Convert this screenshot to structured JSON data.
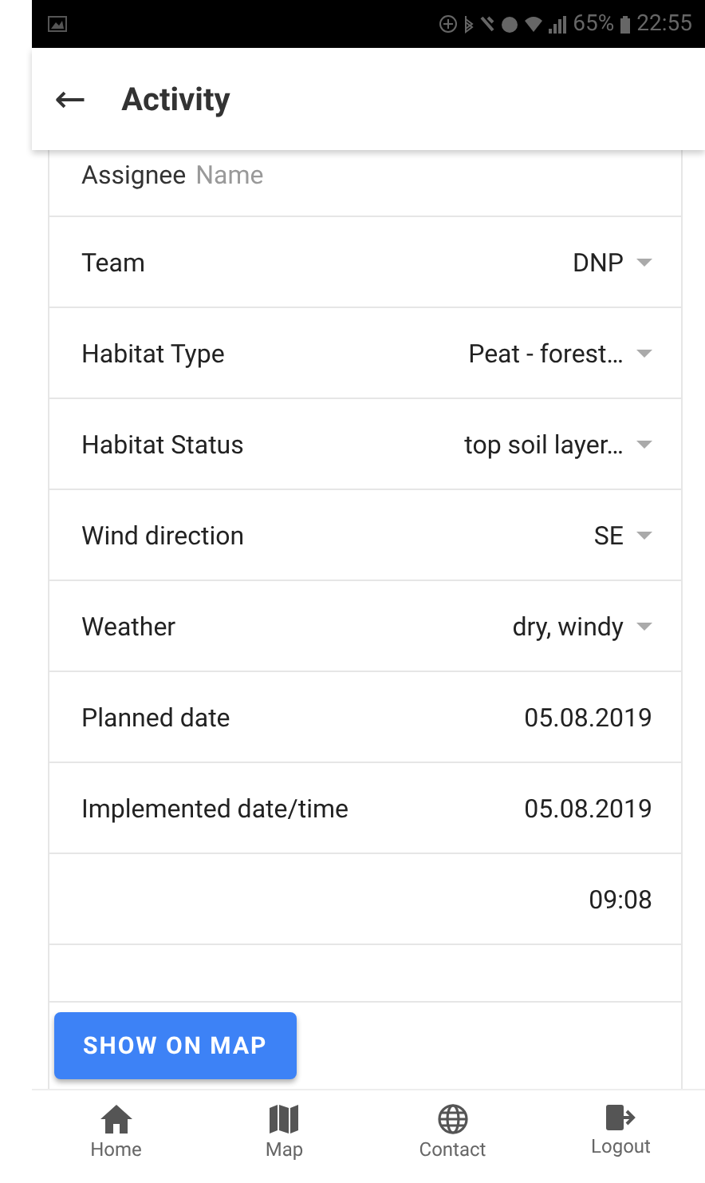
{
  "status_bar": {
    "battery": "65%",
    "time": "22:55"
  },
  "app_bar": {
    "back": "←",
    "title": "Activity"
  },
  "assignee": {
    "label": "Assignee",
    "placeholder": "Name"
  },
  "fields": [
    {
      "kind": "select",
      "label": "Team",
      "value": "DNP"
    },
    {
      "kind": "select",
      "label": "Habitat Type",
      "value": "Peat - forest…"
    },
    {
      "kind": "select",
      "label": "Habitat Status",
      "value": "top soil layer…"
    },
    {
      "kind": "select",
      "label": "Wind direction",
      "value": "SE"
    },
    {
      "kind": "select",
      "label": "Weather",
      "value": "dry, windy"
    },
    {
      "kind": "date",
      "label": "Planned date",
      "value": "05.08.2019"
    },
    {
      "kind": "date",
      "label": "Implemented date/time",
      "value": "05.08.2019"
    },
    {
      "kind": "time",
      "value": "09:08"
    },
    {
      "kind": "empty"
    }
  ],
  "button": "SHOW ON MAP",
  "nav": [
    {
      "kind": "home",
      "label": "Home"
    },
    {
      "kind": "map",
      "label": "Map"
    },
    {
      "kind": "contact",
      "label": "Contact"
    },
    {
      "kind": "logout",
      "label": "Logout"
    }
  ]
}
